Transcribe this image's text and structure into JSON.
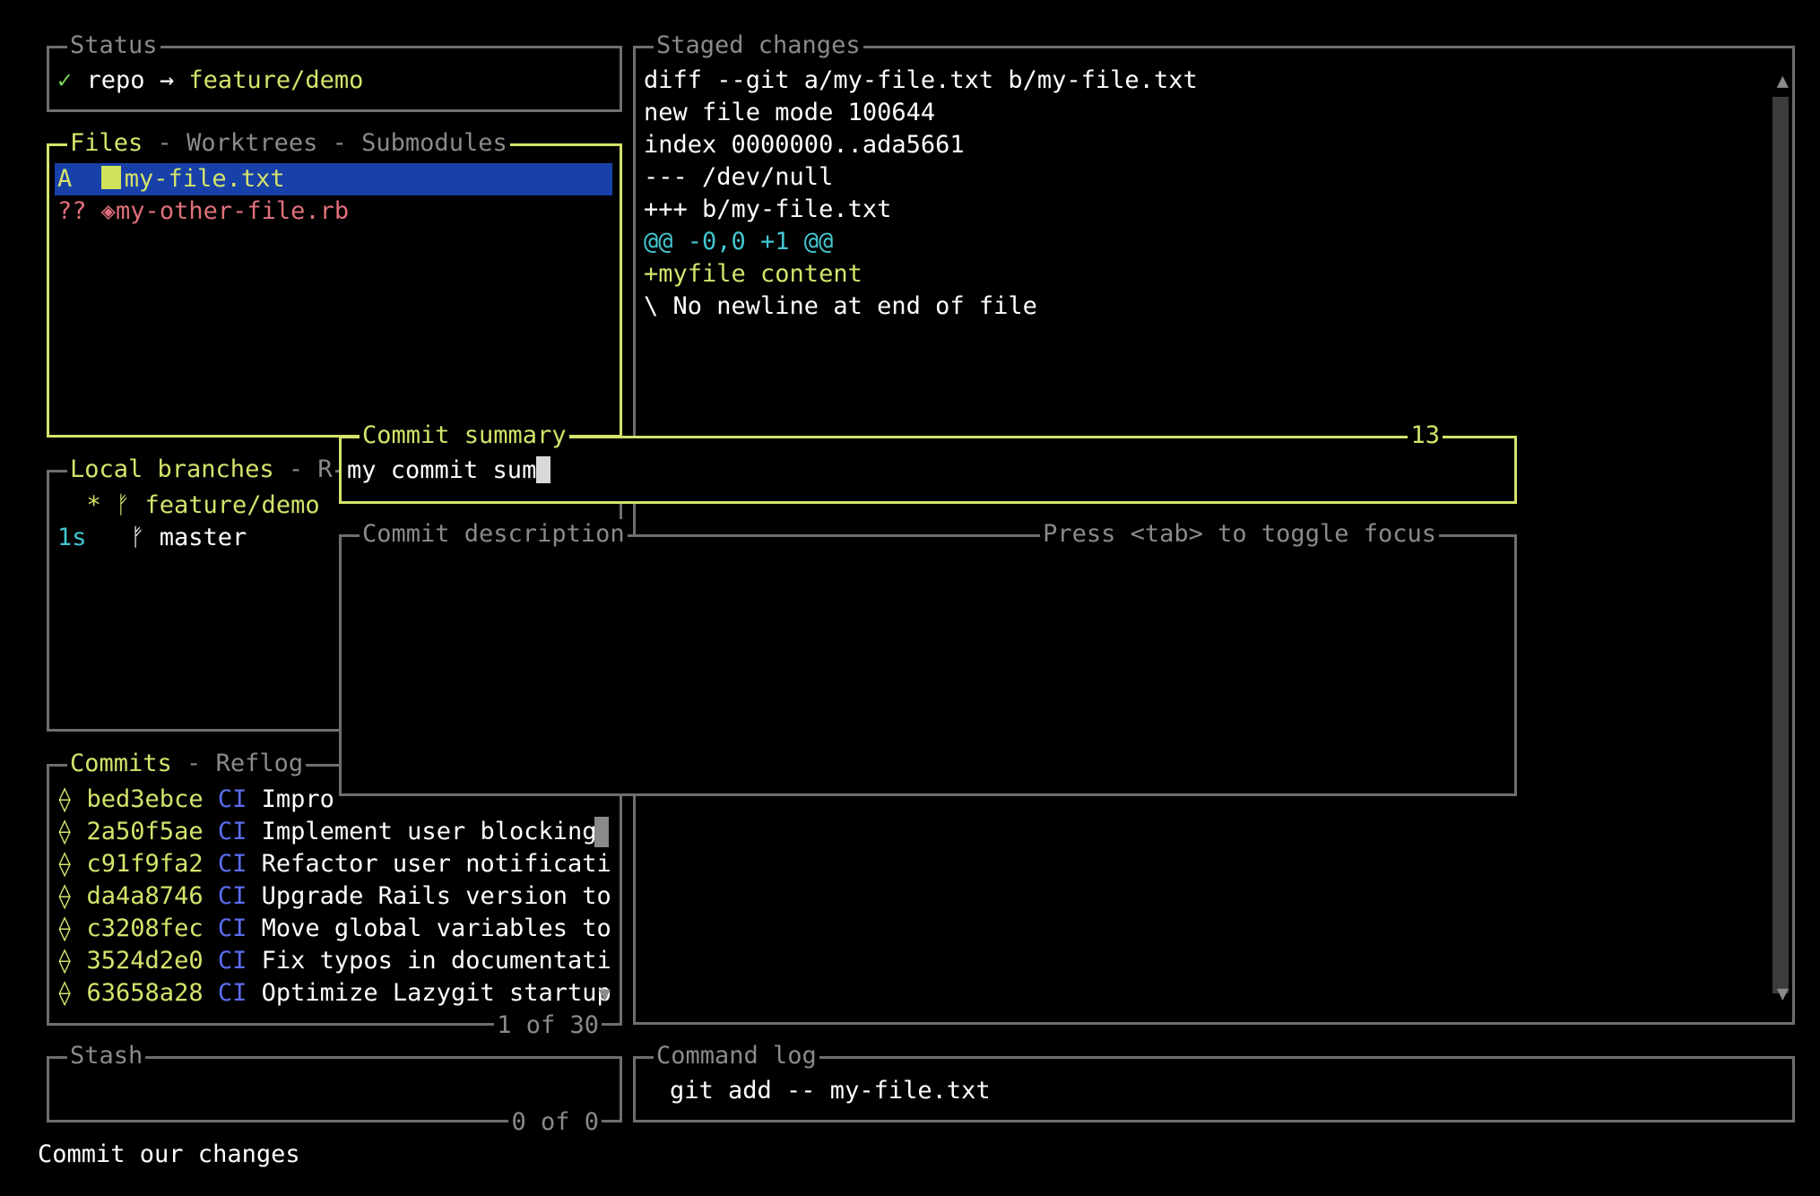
{
  "status": {
    "title": "Status",
    "check": "✓",
    "repo": "repo",
    "arrow": "→",
    "branch": "feature/demo"
  },
  "files": {
    "tabs": [
      "Files",
      "Worktrees",
      "Submodules"
    ],
    "sep": " - ",
    "items": [
      {
        "status": "A",
        "name": "my-file.txt"
      },
      {
        "status": "??",
        "name": "my-other-file.rb"
      }
    ]
  },
  "branches": {
    "tabs": [
      "Local branches",
      "R"
    ],
    "sep": " - ",
    "items": [
      {
        "prefix": "  *",
        "name": "feature/demo"
      },
      {
        "prefix": "1s",
        "name": "master"
      }
    ]
  },
  "commits": {
    "tabs": [
      "Commits",
      "Reflog"
    ],
    "sep": " - ",
    "footer": "1 of 30",
    "items": [
      {
        "hash": "bed3ebce",
        "tag": "CI",
        "msg": "Impro"
      },
      {
        "hash": "2a50f5ae",
        "tag": "CI",
        "msg": "Implement user blocking "
      },
      {
        "hash": "c91f9fa2",
        "tag": "CI",
        "msg": "Refactor user notificati"
      },
      {
        "hash": "da4a8746",
        "tag": "CI",
        "msg": "Upgrade Rails version to"
      },
      {
        "hash": "c3208fec",
        "tag": "CI",
        "msg": "Move global variables to"
      },
      {
        "hash": "3524d2e0",
        "tag": "CI",
        "msg": "Fix typos in documentati"
      },
      {
        "hash": "63658a28",
        "tag": "CI",
        "msg": "Optimize Lazygit startup"
      }
    ]
  },
  "stash": {
    "title": "Stash",
    "footer": "0 of 0"
  },
  "staged": {
    "title": "Staged changes",
    "lines": [
      {
        "text": "diff --git a/my-file.txt b/my-file.txt",
        "color": "white"
      },
      {
        "text": "new file mode 100644",
        "color": "white"
      },
      {
        "text": "index 0000000..ada5661",
        "color": "white"
      },
      {
        "text": "--- /dev/null",
        "color": "white"
      },
      {
        "text": "+++ b/my-file.txt",
        "color": "white"
      },
      {
        "text": "@@ -0,0 +1 @@",
        "color": "cyan"
      },
      {
        "text": "+myfile content",
        "color": "yellow"
      },
      {
        "text": "\\ No newline at end of file",
        "color": "white"
      }
    ]
  },
  "command_log": {
    "title": "Command log",
    "text": "git add -- my-file.txt"
  },
  "commit_summary": {
    "title": "Commit summary",
    "count": "13",
    "value": "my commit sum"
  },
  "commit_description": {
    "title": "Commit description",
    "hint": "Press <tab> to toggle focus"
  },
  "status_bar": "Commit our changes",
  "icons": {
    "commit": "⟠",
    "branch": "ᚠ",
    "gem": "💎"
  }
}
